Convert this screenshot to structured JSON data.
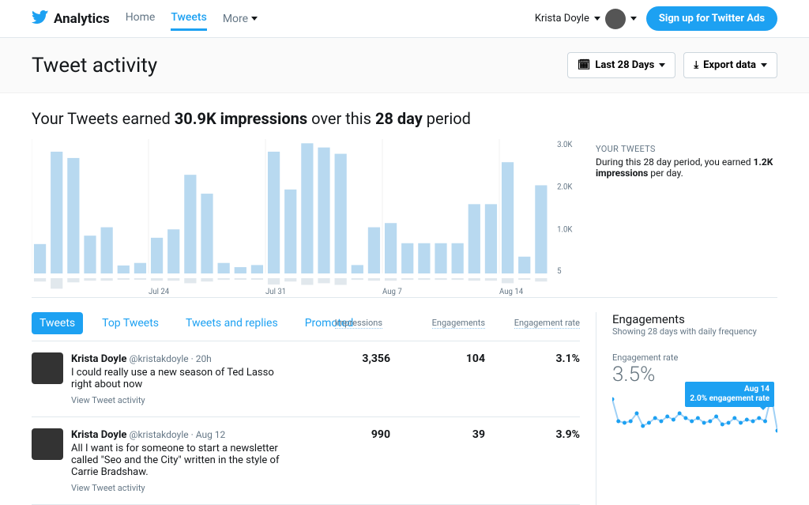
{
  "nav": {
    "brand": "Analytics",
    "links": [
      "Home",
      "Tweets",
      "More"
    ],
    "active_index": 1,
    "user_name": "Krista Doyle ",
    "cta": "Sign up for Twitter Ads"
  },
  "header": {
    "title": "Tweet activity",
    "date_range_label": "Last 28 Days",
    "export_label": "Export data"
  },
  "headline": {
    "prefix": "Your Tweets earned ",
    "impressions": "30.9K impressions",
    "middle": " over this ",
    "period": "28 day",
    "suffix": " period"
  },
  "chart_data": {
    "type": "bar",
    "ylabel": "",
    "ylim": [
      0,
      3200
    ],
    "y_ticks": [
      "3.0K",
      "2.0K",
      "1.0K",
      "5"
    ],
    "x_ticks": [
      "Jul 24",
      "Jul 31",
      "Aug 7",
      "Aug 14"
    ],
    "series": [
      {
        "name": "Impressions",
        "color": "#b8d9f0",
        "values": [
          700,
          2900,
          2750,
          900,
          1100,
          190,
          250,
          850,
          1050,
          2350,
          1900,
          250,
          150,
          200,
          2900,
          2000,
          3100,
          3000,
          2850,
          200,
          1100,
          1200,
          720,
          720,
          720,
          720,
          1650,
          1650,
          2650,
          400,
          2100
        ]
      },
      {
        "name": "Secondary",
        "color": "#e1e8ed",
        "values": [
          80,
          250,
          100,
          60,
          60,
          30,
          30,
          60,
          60,
          120,
          80,
          40,
          30,
          30,
          150,
          80,
          160,
          120,
          160,
          40,
          60,
          60,
          40,
          40,
          40,
          40,
          60,
          60,
          120,
          30,
          80
        ]
      }
    ]
  },
  "side_summary": {
    "label": "YOUR TWEETS",
    "text_prefix": "During this 28 day period, you earned ",
    "bold": "1.2K impressions",
    "text_suffix": " per day."
  },
  "tabs": {
    "items": [
      "Tweets",
      "Top Tweets",
      "Tweets and replies",
      "Promoted"
    ],
    "active_index": 0,
    "col_impressions": "Impressions",
    "col_engagements": "Engagements",
    "col_rate": "Engagement rate"
  },
  "tweets": [
    {
      "name": "Krista Doyle ",
      "handle": "@kristakdoyle",
      "time": "20h",
      "text": "I could really use a new season of Ted Lasso right about now",
      "view": "View Tweet activity",
      "impressions": "3,356",
      "engagements": "104",
      "rate": "3.1%"
    },
    {
      "name": "Krista Doyle ",
      "handle": "@kristakdoyle",
      "time": "Aug 12",
      "text": "All I want is for someone to start a newsletter called \"Seo and the City\" written in the style of Carrie Bradshaw.",
      "view": "View Tweet activity",
      "impressions": "990",
      "engagements": "39",
      "rate": "3.9%"
    }
  ],
  "engagements_panel": {
    "title": "Engagements",
    "subtitle": "Showing 28 days with daily frequency",
    "rate_label": "Engagement rate",
    "rate_value": "3.5%",
    "tooltip_date": "Aug 14",
    "tooltip_text": "2.0% engagement rate",
    "spark_values": [
      6.0,
      3.2,
      3.0,
      3.2,
      4.2,
      2.6,
      3.0,
      3.6,
      3.2,
      3.8,
      3.4,
      4.2,
      3.6,
      3.2,
      3.6,
      3.0,
      3.2,
      3.8,
      2.8,
      3.0,
      3.6,
      3.0,
      3.4,
      3.2,
      3.6,
      3.2,
      6.4,
      2.0
    ]
  }
}
